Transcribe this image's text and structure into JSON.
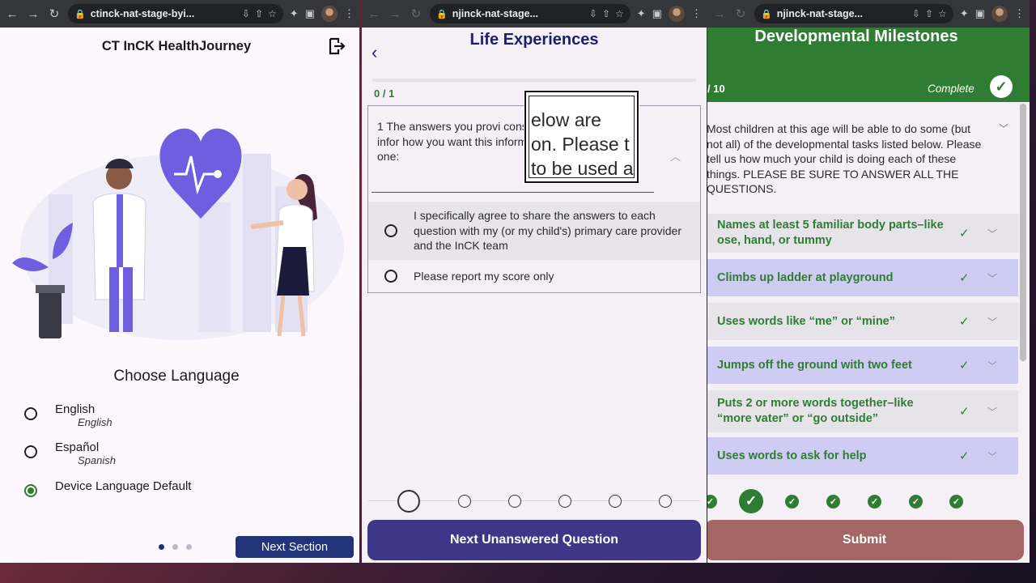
{
  "left_window": {
    "url": "ctinck-nat-stage-byi...",
    "app_title": "CT InCK HealthJourney",
    "choose_language": "Choose Language",
    "languages": [
      {
        "name": "English",
        "sub": "English",
        "selected": false
      },
      {
        "name": "Español",
        "sub": "Spanish",
        "selected": false
      },
      {
        "name": "Device Language Default",
        "sub": "",
        "selected": true
      }
    ],
    "next_section": "Next Section",
    "page_dots": {
      "count": 3,
      "active": 0
    }
  },
  "middle_window": {
    "url": "njinck-nat-stage...",
    "title": "Life Experiences",
    "progress_label": "0 / 1",
    "progress_fraction": 0,
    "question": "1   The answers you provi considered sensitive infor how you want this informa shared. Choose one:",
    "magnifier_lines": [
      "elow are",
      "on. Please t",
      "to be used a"
    ],
    "options": [
      {
        "label": "I specifically agree to share the answers to each question with my (or my child's) primary care provider and the InCK team",
        "selected": false
      },
      {
        "label": "Please report my score only",
        "selected": false
      }
    ],
    "next_button": "Next Unanswered Question"
  },
  "right_window": {
    "url": "njinck-nat-stage...",
    "title": "Developmental Milestones",
    "count": "/ 10",
    "status": "Complete",
    "intro": "Most children at this age will be able to do some (but not all) of the developmental tasks listed below. Please tell us how much your child is doing each of these things. PLEASE BE SURE TO ANSWER ALL THE QUESTIONS.",
    "items": [
      {
        "label": "Names at least 5 familiar body parts–like ose, hand, or tummy",
        "style": "gray"
      },
      {
        "label": "Climbs up ladder at playground",
        "style": "purple"
      },
      {
        "label": "Uses words like “me” or “mine”",
        "style": "gray"
      },
      {
        "label": "Jumps off the ground with two feet",
        "style": "purple"
      },
      {
        "label": "Puts 2 or more words together–like “more vater” or “go outside”",
        "style": "gray"
      },
      {
        "label": "Uses words to ask for help",
        "style": "purple"
      }
    ],
    "submit": "Submit"
  },
  "colors": {
    "green": "#2f7d32",
    "navy": "#23337a",
    "purple_button": "#3e3687",
    "submit_button": "#a46565",
    "illustration_purple": "#6f5fe0"
  },
  "icons": {
    "chrome_nav": [
      "back-arrow-icon",
      "forward-arrow-icon",
      "reload-icon"
    ],
    "logout": "logout-icon",
    "check": "check-icon",
    "chevron": "chevron-down-icon"
  }
}
